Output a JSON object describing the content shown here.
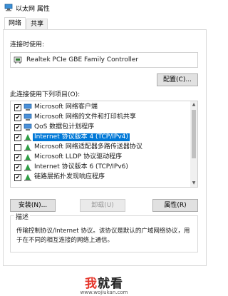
{
  "window": {
    "title": "以太网 属性"
  },
  "tabs": [
    {
      "label": "网络"
    },
    {
      "label": "共享"
    }
  ],
  "connect_using": {
    "label": "连接时使用:",
    "adapter": "Realtek PCIe GBE Family Controller",
    "configure_label": "配置(C)..."
  },
  "items_label": "此连接使用下列项目(O):",
  "items": [
    {
      "label": "Microsoft 网络客户端",
      "checked": true,
      "icon": "network-client-icon"
    },
    {
      "label": "Microsoft 网络的文件和打印机共享",
      "checked": true,
      "icon": "file-printer-sharing-icon"
    },
    {
      "label": "QoS 数据包计划程序",
      "checked": true,
      "icon": "qos-icon"
    },
    {
      "label": "Internet 协议版本 4 (TCP/IPv4)",
      "checked": true,
      "icon": "protocol-icon",
      "selected": true
    },
    {
      "label": "Microsoft 网络适配器多路传送器协议",
      "checked": false,
      "icon": "protocol-icon"
    },
    {
      "label": "Microsoft LLDP 协议驱动程序",
      "checked": true,
      "icon": "protocol-icon"
    },
    {
      "label": "Internet 协议版本 6 (TCP/IPv6)",
      "checked": true,
      "icon": "protocol-icon"
    },
    {
      "label": "链路层拓扑发现响应程序",
      "checked": true,
      "icon": "protocol-icon"
    }
  ],
  "buttons": {
    "install": "安装(N)...",
    "uninstall": "卸载(U)",
    "properties": "属性(R)"
  },
  "description": {
    "title": "描述",
    "text": "传输控制协议/Internet 协议。该协议是默认的广域网络协议，用于在不同的相互连接的网络上通信。"
  },
  "watermark": {
    "logo_red": "我",
    "logo_black": "就看",
    "url": "www.wojiukan.com"
  },
  "colors": {
    "accent": "#0078d7",
    "watermark_red": "#e5352a"
  }
}
